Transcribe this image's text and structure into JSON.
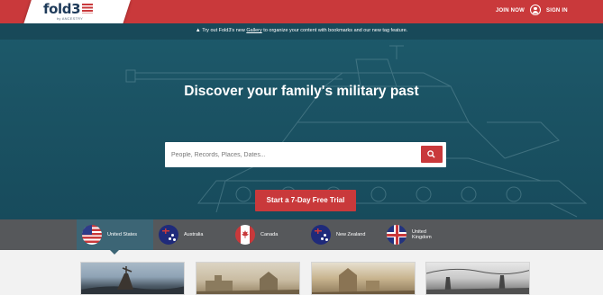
{
  "header": {
    "logo_text": "fold3",
    "logo_sub": "by ANCESTRY",
    "join_label": "JOIN NOW",
    "signin_label": "SIGN IN",
    "colors": {
      "brand_red": "#c9393b",
      "logo_navy": "#1f3b5a"
    }
  },
  "notice": {
    "icon": "warning-icon",
    "before": "Try out Fold3's new ",
    "link": "Gallery",
    "after": " to organize your content with bookmarks and our new tag feature."
  },
  "hero": {
    "headline": "Discover your family's military past",
    "search_placeholder": "People, Records, Places, Dates...",
    "search_icon": "search-icon",
    "cta_label": "Start a 7-Day Free Trial",
    "colors": {
      "hero_teal": "#1b5364",
      "button_red": "#c9393b"
    }
  },
  "countries": {
    "selected": "United States",
    "items": [
      {
        "label": "United States",
        "flag": "us-flag-icon"
      },
      {
        "label": "Australia",
        "flag": "australia-flag-icon"
      },
      {
        "label": "Canada",
        "flag": "canada-flag-icon"
      },
      {
        "label": "New Zealand",
        "flag": "new-zealand-flag-icon"
      },
      {
        "label_line1": "United",
        "label_line2": "Kingdom",
        "flag": "uk-flag-icon"
      }
    ]
  }
}
